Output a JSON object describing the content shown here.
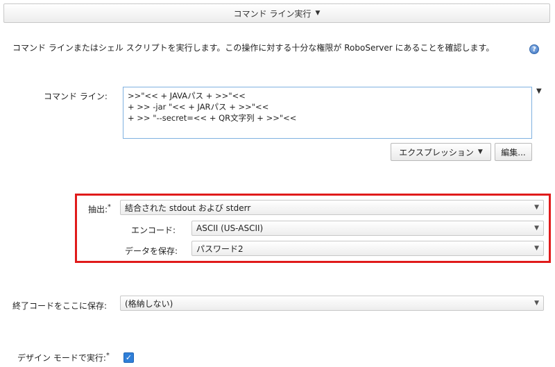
{
  "header": {
    "title": "コマンド ライン実行"
  },
  "description": "コマンド ラインまたはシェル スクリプトを実行します。この操作に対する十分な権限が RoboServer にあることを確認します。",
  "help_icon": "?",
  "command": {
    "label": "コマンド ライン:",
    "lines": [
      ">>\"<< + JAVAパス + >>\"<<",
      "+ >> -jar \"<< + JARパス + >>\"<<",
      "+ >> \"--secret=<< + QR文字列 + >>\"<<"
    ],
    "expression_button": "エクスプレッション",
    "edit_button": "編集..."
  },
  "extract": {
    "label": "抽出:",
    "required_mark": "*",
    "value": "結合された stdout および stderr",
    "encode_label": "エンコード:",
    "encode_value": "ASCII (US-ASCII)",
    "save_label": "データを保存:",
    "save_value": "パスワード2"
  },
  "exit_code": {
    "label": "終了コードをここに保存:",
    "value": "(格納しない)"
  },
  "design_mode": {
    "label": "デザイン モードで実行:",
    "required_mark": "*",
    "checked": true,
    "check_glyph": "✓"
  },
  "colors": {
    "highlight": "#e01b1b",
    "accent": "#2f7fd8"
  }
}
